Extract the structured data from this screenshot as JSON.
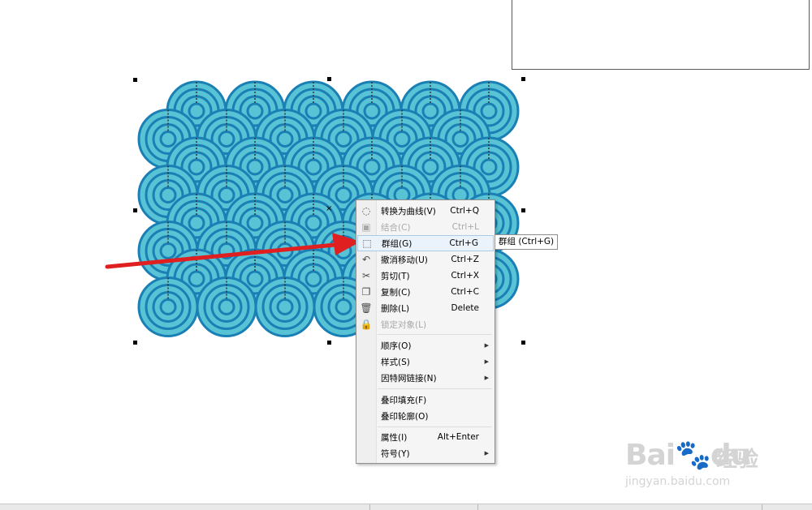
{
  "context_menu": {
    "items": [
      {
        "icon": "convert-to-curve-icon",
        "label": "转换为曲线(V)",
        "shortcut": "Ctrl+Q",
        "disabled": false,
        "submenu": false
      },
      {
        "icon": "combine-icon",
        "label": "结合(C)",
        "shortcut": "Ctrl+L",
        "disabled": true,
        "submenu": false
      },
      {
        "icon": "group-icon",
        "label": "群组(G)",
        "shortcut": "Ctrl+G",
        "disabled": false,
        "submenu": false,
        "highlighted": true
      },
      {
        "icon": "undo-icon",
        "label": "撤消移动(U)",
        "shortcut": "Ctrl+Z",
        "disabled": false,
        "submenu": false
      },
      {
        "icon": "scissors-icon",
        "label": "剪切(T)",
        "shortcut": "Ctrl+X",
        "disabled": false,
        "submenu": false
      },
      {
        "icon": "copy-icon",
        "label": "复制(C)",
        "shortcut": "Ctrl+C",
        "disabled": false,
        "submenu": false
      },
      {
        "icon": "trash-icon",
        "label": "删除(L)",
        "shortcut": "Delete",
        "disabled": false,
        "submenu": false
      },
      {
        "icon": "lock-icon",
        "label": "锁定对象(L)",
        "shortcut": "",
        "disabled": true,
        "submenu": false
      },
      {
        "icon": "",
        "label": "顺序(O)",
        "shortcut": "",
        "disabled": false,
        "submenu": true
      },
      {
        "icon": "",
        "label": "样式(S)",
        "shortcut": "",
        "disabled": false,
        "submenu": true
      },
      {
        "icon": "",
        "label": "因特网链接(N)",
        "shortcut": "",
        "disabled": false,
        "submenu": true
      },
      {
        "icon": "",
        "label": "叠印填充(F)",
        "shortcut": "",
        "disabled": false,
        "submenu": false
      },
      {
        "icon": "",
        "label": "叠印轮廓(O)",
        "shortcut": "",
        "disabled": false,
        "submenu": false
      },
      {
        "icon": "",
        "label": "属性(I)",
        "shortcut": "Alt+Enter",
        "disabled": false,
        "submenu": false
      },
      {
        "icon": "",
        "label": "符号(Y)",
        "shortcut": "",
        "disabled": false,
        "submenu": true
      }
    ]
  },
  "tooltip": {
    "text": "群组 (Ctrl+G)"
  },
  "canvas": {
    "circle_fill": "#58c3d4",
    "circle_stroke": "#1a7fb5",
    "arrow_color": "#e02020"
  },
  "watermark": {
    "logo": "Bai",
    "logo_paw": "du",
    "chinese": "经验",
    "url": "jingyan.baidu.com"
  }
}
